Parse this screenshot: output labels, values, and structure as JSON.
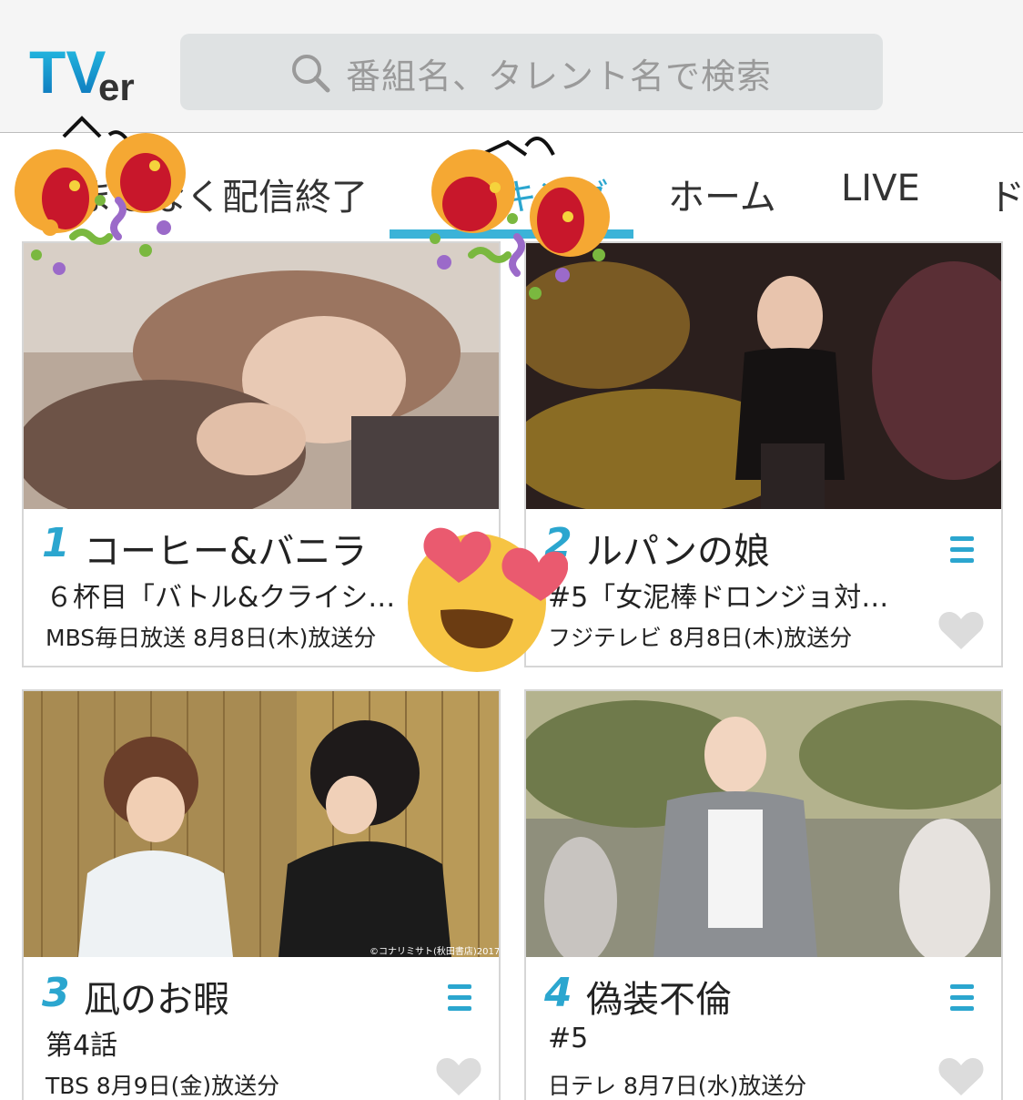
{
  "header": {
    "logo_text": "TVer",
    "search_placeholder": "番組名、タレント名で検索"
  },
  "tabs": [
    {
      "label": "まもなく配信終了"
    },
    {
      "label": "ランキング"
    },
    {
      "label": "ホーム"
    },
    {
      "label": "LIVE"
    },
    {
      "label": "ド"
    }
  ],
  "active_tab_index": 1,
  "accent_color": "#3bb3d8",
  "cards": [
    {
      "rank": "1",
      "title": "コーヒー&バニラ",
      "subtitle": "６杯目「バトル&クライシ…",
      "meta": "MBS毎日放送  8月8日(木)放送分"
    },
    {
      "rank": "2",
      "title": "ルパンの娘",
      "subtitle": "#5「女泥棒ドロンジョ対…",
      "meta": "フジテレビ  8月8日(木)放送分"
    },
    {
      "rank": "3",
      "title": "凪のお暇",
      "subtitle": "第4話",
      "meta": "TBS  8月9日(金)放送分",
      "credit": "©コナリミサト(秋田書店)2017"
    },
    {
      "rank": "4",
      "title": "偽装不倫",
      "subtitle": "#5",
      "meta": "日テレ  8月7日(水)放送分"
    }
  ],
  "stickers": [
    "party-popper-icon",
    "party-popper-icon",
    "heart-eyes-emoji-icon"
  ]
}
